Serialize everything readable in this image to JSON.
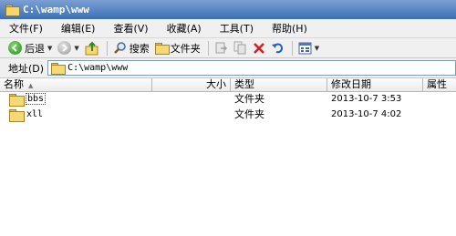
{
  "window": {
    "title": "C:\\wamp\\www"
  },
  "menu": {
    "items": [
      {
        "label": "文件(F)"
      },
      {
        "label": "编辑(E)"
      },
      {
        "label": "查看(V)"
      },
      {
        "label": "收藏(A)"
      },
      {
        "label": "工具(T)"
      },
      {
        "label": "帮助(H)"
      }
    ]
  },
  "toolbar": {
    "back_label": "后退",
    "search_label": "搜索",
    "folders_label": "文件夹"
  },
  "address": {
    "label": "地址(D)",
    "value": "C:\\wamp\\www"
  },
  "columns": {
    "name": "名称",
    "size": "大小",
    "type": "类型",
    "modified": "修改日期",
    "attributes": "属性"
  },
  "files": [
    {
      "name": "bbs",
      "size": "",
      "type": "文件夹",
      "modified": "2013-10-7 3:53",
      "attributes": ""
    },
    {
      "name": "xll",
      "size": "",
      "type": "文件夹",
      "modified": "2013-10-7 4:02",
      "attributes": ""
    }
  ],
  "colors": {
    "titlebar": "#3c6fb5",
    "folder": "#f6d874",
    "delete": "#d02020",
    "undo": "#1e5fc0"
  }
}
